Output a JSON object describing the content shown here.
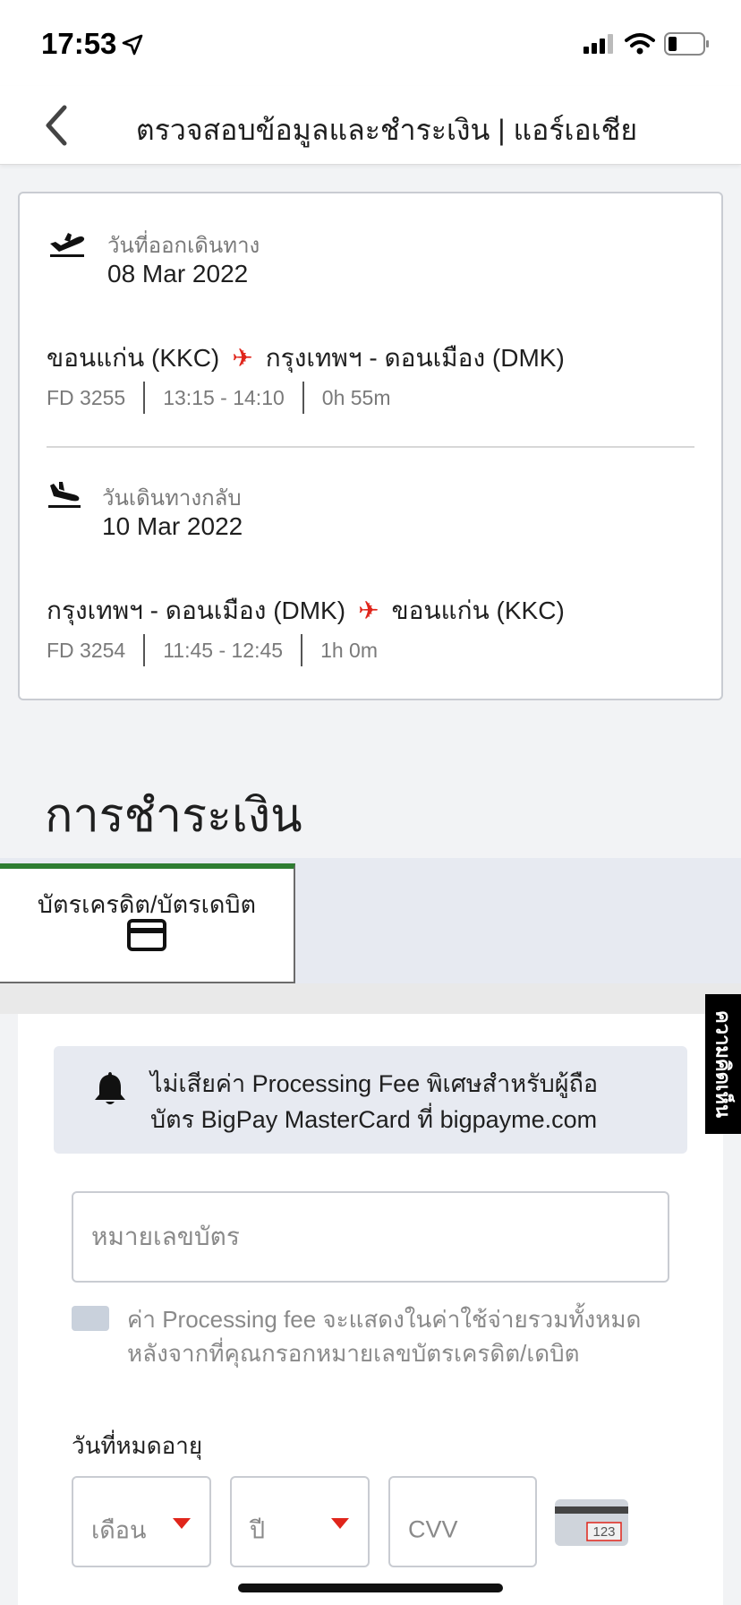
{
  "status": {
    "time": "17:53"
  },
  "nav": {
    "title": "ตรวจสอบข้อมูลและชำระเงิน | แอร์เอเชีย"
  },
  "flights": {
    "outbound": {
      "date_label": "วันที่ออกเดินทาง",
      "date": "08 Mar 2022",
      "origin": "ขอนแก่น (KKC)",
      "destination": "กรุงเทพฯ - ดอนเมือง (DMK)",
      "flight_no": "FD 3255",
      "time": "13:15 - 14:10",
      "duration": "0h 55m"
    },
    "return": {
      "date_label": "วันเดินทางกลับ",
      "date": "10 Mar 2022",
      "origin": "กรุงเทพฯ - ดอนเมือง (DMK)",
      "destination": "ขอนแก่น (KKC)",
      "flight_no": "FD 3254",
      "time": "11:45 - 12:45",
      "duration": "1h 0m"
    }
  },
  "payment": {
    "heading": "การชำระเงิน",
    "tab_label": "บัตรเครดิต/บัตรเดบิต",
    "notice_line1": "ไม่เสียค่า Processing Fee พิเศษสำหรับผู้ถือ",
    "notice_line2": "บัตร BigPay MasterCard ที่ bigpayme.com",
    "card_number_placeholder": "หมายเลขบัตร",
    "fee_note": "ค่า Processing fee จะแสดงในค่าใช้จ่ายรวมทั้งหมดหลังจากที่คุณกรอกหมายเลขบัตรเครดิต/เดบิต",
    "expiry_label": "วันที่หมดอายุ",
    "month_placeholder": "เดือน",
    "year_placeholder": "ปี",
    "cvv_placeholder": "CVV",
    "cvv_hint_text": "123"
  },
  "feedback": {
    "label": "ความคิดเห็น"
  },
  "colors": {
    "accent_red": "#e0251b",
    "tab_green": "#2e7d32",
    "notice_bg": "#e7eaf1"
  }
}
